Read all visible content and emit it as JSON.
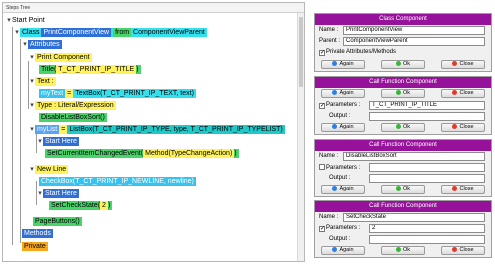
{
  "tree": {
    "caption": "Steps Tree",
    "start_point": "Start Point",
    "class_kw": "Class",
    "class_name": "PrintComponentView",
    "from_kw": "from",
    "class_parent": "ComponentViewParent",
    "attributes": "Attributes",
    "print_component": "Print Component",
    "title_call": "Title(",
    "title_arg": "T_CT_PRINT_IP_TITLE",
    "title_close": ")",
    "text_label": "Text :",
    "mytext": "myText",
    "mytext_eq": " = ",
    "textbox_call": "TextBox(T_CT_PRINT_IP_TEXT, text)",
    "type_label": "Type : Literal/Expression",
    "disable_sort": "DisableListBoxSort()",
    "mylist": "myList",
    "mylist_eq": " = ",
    "listbox_call": "ListBox(T_CT_PRINT_IP_TYPE, type, T_CT_PRINT_IP_TYPELIST)",
    "start_here_1": "Start Here",
    "set_current": "SetCurrentItemChangedEvent(",
    "set_current_arg": "Method(TypeChangeAction)",
    "set_current_close": ")",
    "new_line": "New Line",
    "checkbox_call": "CheckBox(T_CT_PRINT_IP_NEWLINE, newline)",
    "start_here_2": "Start Here",
    "set_check": "SetCheckState(",
    "set_check_arg": "2",
    "set_check_close": ")",
    "page_buttons": "PageButtons()",
    "methods": "Methods",
    "private": "Private"
  },
  "panels": {
    "class_component": {
      "title": "Class Component",
      "name_label": "Name :",
      "name_value": "PrintComponentView",
      "parent_label": "Parent :",
      "parent_value": "ComponentViewParent",
      "private_label": "Private Attributes/Methods",
      "private_checked": true
    },
    "call_function_1": {
      "title": "Call Function Component",
      "again": "Again",
      "ok": "Ok",
      "close": "Close",
      "params_label": "Parameters :",
      "params_value": "T_CT_PRINT_IP_TITLE",
      "output_label": "Output :",
      "output_value": ""
    },
    "call_function_2": {
      "title": "Call Function Component",
      "name_label": "Name :",
      "name_value": "DisableListBoxSort",
      "params_label": "Parameters :",
      "params_value": "",
      "output_label": "Output :",
      "output_value": "",
      "again": "Again",
      "ok": "Ok",
      "close": "Close"
    },
    "call_function_3": {
      "title": "Call Function Component",
      "name_label": "Name :",
      "name_value": "SetCheckState",
      "params_label": "Parameters :",
      "params_value": "2",
      "output_label": "Output :",
      "output_value": "",
      "again": "Again",
      "ok": "Ok",
      "close": "Close"
    }
  },
  "colors": {
    "panel_title": "#97129a",
    "cyan": "#33e0ee",
    "blue": "#2f6fd8",
    "yellow": "#fff25a",
    "green": "#49d46a",
    "orange": "#f6a71b"
  }
}
